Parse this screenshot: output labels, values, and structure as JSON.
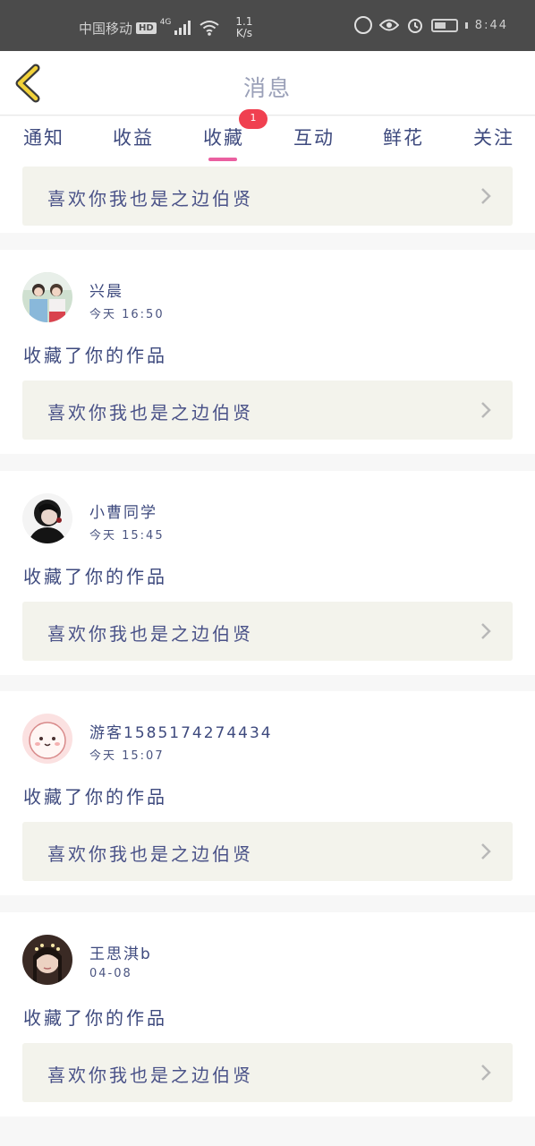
{
  "status_bar": {
    "carrier": "中国移动",
    "hd": "HD",
    "network": "4G",
    "speed_value": "1.1",
    "speed_unit": "K/s",
    "time": "8:44"
  },
  "header": {
    "title": "消息"
  },
  "tabs": [
    {
      "label": "通知"
    },
    {
      "label": "收益"
    },
    {
      "label": "收藏",
      "badge": "1",
      "active": true
    },
    {
      "label": "互动"
    },
    {
      "label": "鲜花"
    },
    {
      "label": "关注"
    }
  ],
  "partial_item": {
    "work_title": "喜欢你我也是之边伯贤"
  },
  "items": [
    {
      "name": "兴晨",
      "time": "今天 16:50",
      "action": "收藏了你的作品",
      "work_title": "喜欢你我也是之边伯贤"
    },
    {
      "name": "小曹同学",
      "time": "今天 15:45",
      "action": "收藏了你的作品",
      "work_title": "喜欢你我也是之边伯贤"
    },
    {
      "name": "游客1585174274434",
      "time": "今天 15:07",
      "action": "收藏了你的作品",
      "work_title": "喜欢你我也是之边伯贤"
    },
    {
      "name": "王思淇b",
      "time": "04-08",
      "action": "收藏了你的作品",
      "work_title": "喜欢你我也是之边伯贤"
    }
  ],
  "colors": {
    "accent_pink": "#ea5fa0",
    "badge_red": "#f04050",
    "text_navy": "#3e4a7e",
    "back_arrow_yellow": "#f2d23a"
  }
}
